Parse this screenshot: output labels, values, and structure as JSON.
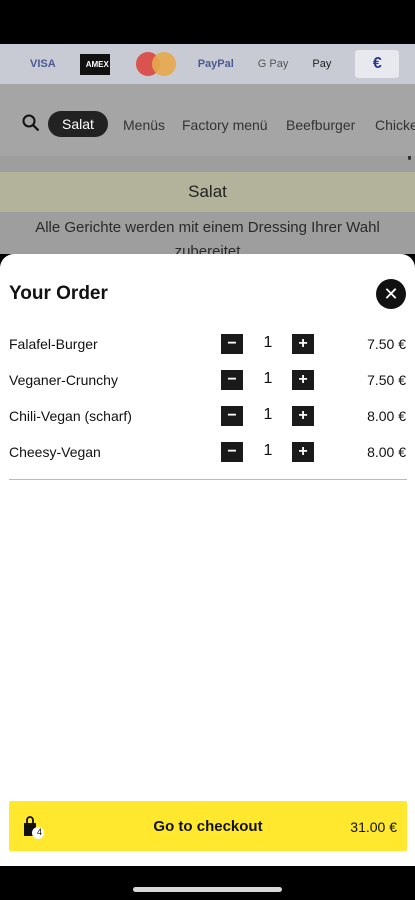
{
  "payments": {
    "visa": "VISA",
    "amex": "AMEX",
    "paypal": "PayPal",
    "gpay": "G Pay",
    "applepay": "Pay",
    "euro": "€"
  },
  "category_nav": {
    "active": "Salat",
    "items": [
      "Menüs",
      "Factory menü",
      "Beefburger",
      "Chicke"
    ]
  },
  "section": {
    "title": "Salat",
    "description_line1": "Alle Gerichte werden mit einem Dressing Ihrer Wahl",
    "description_line2": "zubereitet"
  },
  "order": {
    "title": "Your Order",
    "items": [
      {
        "name": "Falafel-Burger",
        "qty": "1",
        "price": "7.50 €"
      },
      {
        "name": "Veganer-Crunchy",
        "qty": "1",
        "price": "7.50 €"
      },
      {
        "name": "Chili-Vegan (scharf)",
        "qty": "1",
        "price": "8.00 €"
      },
      {
        "name": "Cheesy-Vegan",
        "qty": "1",
        "price": "8.00 €"
      }
    ],
    "minus_symbol": "−",
    "plus_symbol": "+",
    "close_symbol": "✕"
  },
  "checkout": {
    "label": "Go to checkout",
    "total": "31.00 €",
    "bag_count": "4"
  }
}
